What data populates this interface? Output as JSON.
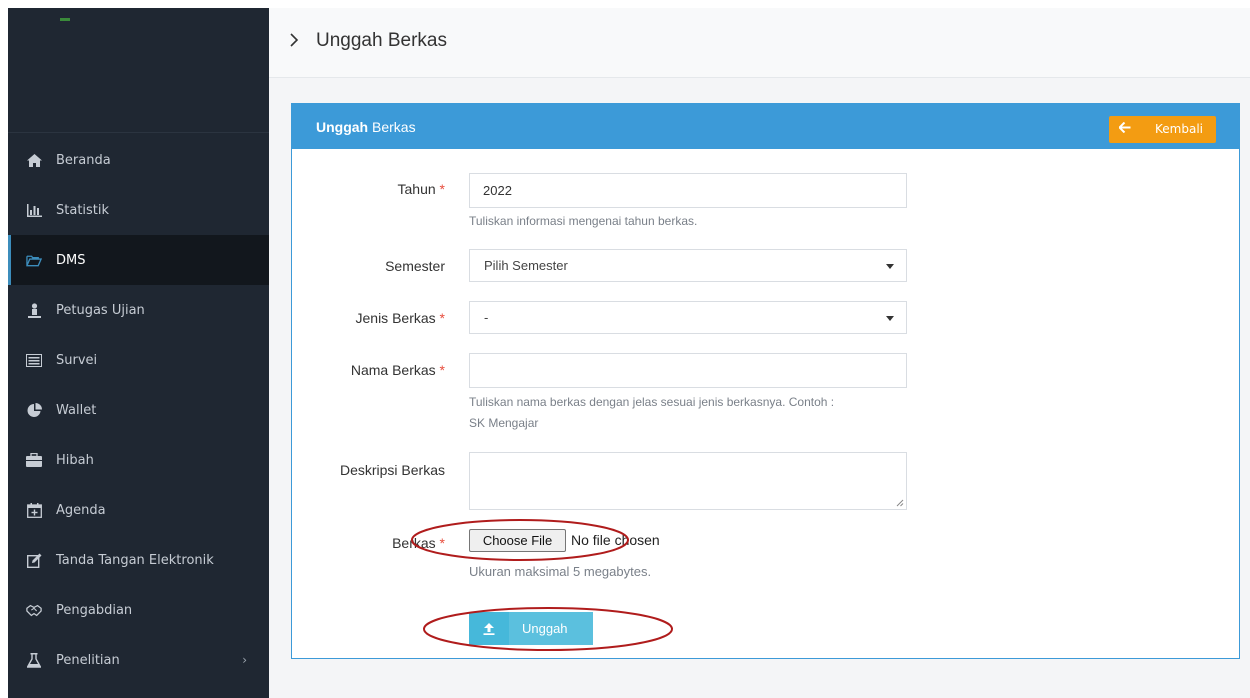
{
  "page": {
    "title": "Unggah Berkas"
  },
  "sidebar": {
    "items": [
      {
        "label": "Beranda",
        "icon": "home-icon"
      },
      {
        "label": "Statistik",
        "icon": "bar-chart-icon"
      },
      {
        "label": "DMS",
        "icon": "folder-open-icon",
        "active": true
      },
      {
        "label": "Petugas Ujian",
        "icon": "person-icon"
      },
      {
        "label": "Survei",
        "icon": "list-icon"
      },
      {
        "label": "Wallet",
        "icon": "pie-chart-icon"
      },
      {
        "label": "Hibah",
        "icon": "briefcase-icon"
      },
      {
        "label": "Agenda",
        "icon": "calendar-plus-icon"
      },
      {
        "label": "Tanda Tangan Elektronik",
        "icon": "edit-icon"
      },
      {
        "label": "Pengabdian",
        "icon": "handshake-icon"
      },
      {
        "label": "Penelitian",
        "icon": "flask-icon",
        "has_submenu": true
      }
    ]
  },
  "panel": {
    "title_bold": "Unggah",
    "title_rest": "Berkas",
    "back_label": "Kembali"
  },
  "form": {
    "tahun": {
      "label": "Tahun",
      "value": "2022",
      "help": "Tuliskan informasi mengenai tahun berkas."
    },
    "semester": {
      "label": "Semester",
      "selected": "Pilih Semester"
    },
    "jenis": {
      "label": "Jenis Berkas",
      "selected": "-"
    },
    "nama": {
      "label": "Nama Berkas",
      "value": "",
      "help_line1": "Tuliskan nama berkas dengan jelas sesuai jenis berkasnya. Contoh :",
      "help_line2": "SK Mengajar"
    },
    "deskripsi": {
      "label": "Deskripsi Berkas",
      "value": ""
    },
    "berkas": {
      "label": "Berkas",
      "button": "Choose File",
      "status": "No file chosen",
      "help": "Ukuran maksimal 5 megabytes."
    },
    "required_mark": "*",
    "submit_label": "Unggah"
  },
  "colors": {
    "sidebar_bg": "#1f2732",
    "active_accent": "#3c8dbc",
    "panel_header": "#3c9ad8",
    "back_button": "#f39c12",
    "upload_button": "#5bc0de",
    "required": "#e74c3c",
    "annotation": "#b01c1c"
  }
}
